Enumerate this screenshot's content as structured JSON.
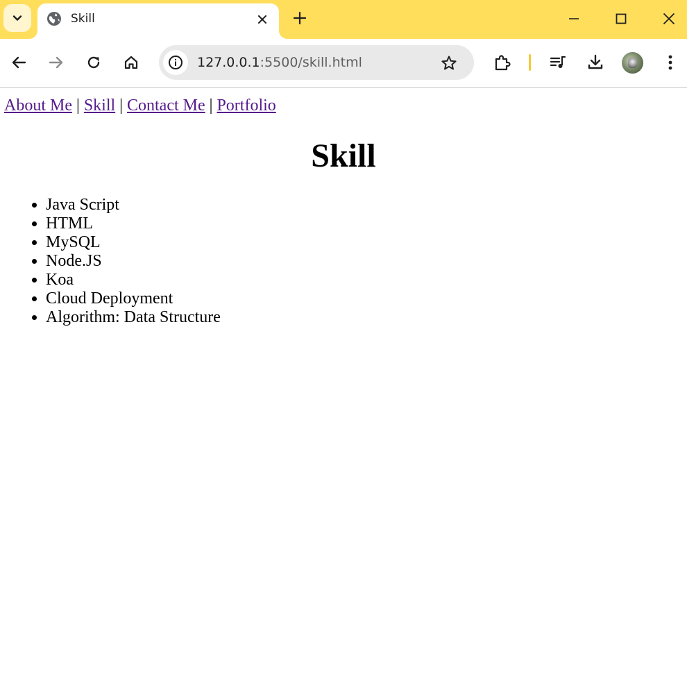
{
  "browser": {
    "tab": {
      "title": "Skill"
    },
    "url": {
      "host": "127.0.0.1",
      "path": ":5500/skill.html"
    },
    "colors": {
      "frame": "#ffde5c",
      "link": "#551a8b"
    }
  },
  "page": {
    "nav": [
      {
        "label": "About Me"
      },
      {
        "label": "Skill"
      },
      {
        "label": "Contact Me"
      },
      {
        "label": "Portfolio"
      }
    ],
    "separator": "|",
    "title": "Skill",
    "skills": [
      "Java Script",
      "HTML",
      "MySQL",
      "Node.JS",
      "Koa",
      "Cloud Deployment",
      "Algorithm: Data Structure"
    ]
  }
}
